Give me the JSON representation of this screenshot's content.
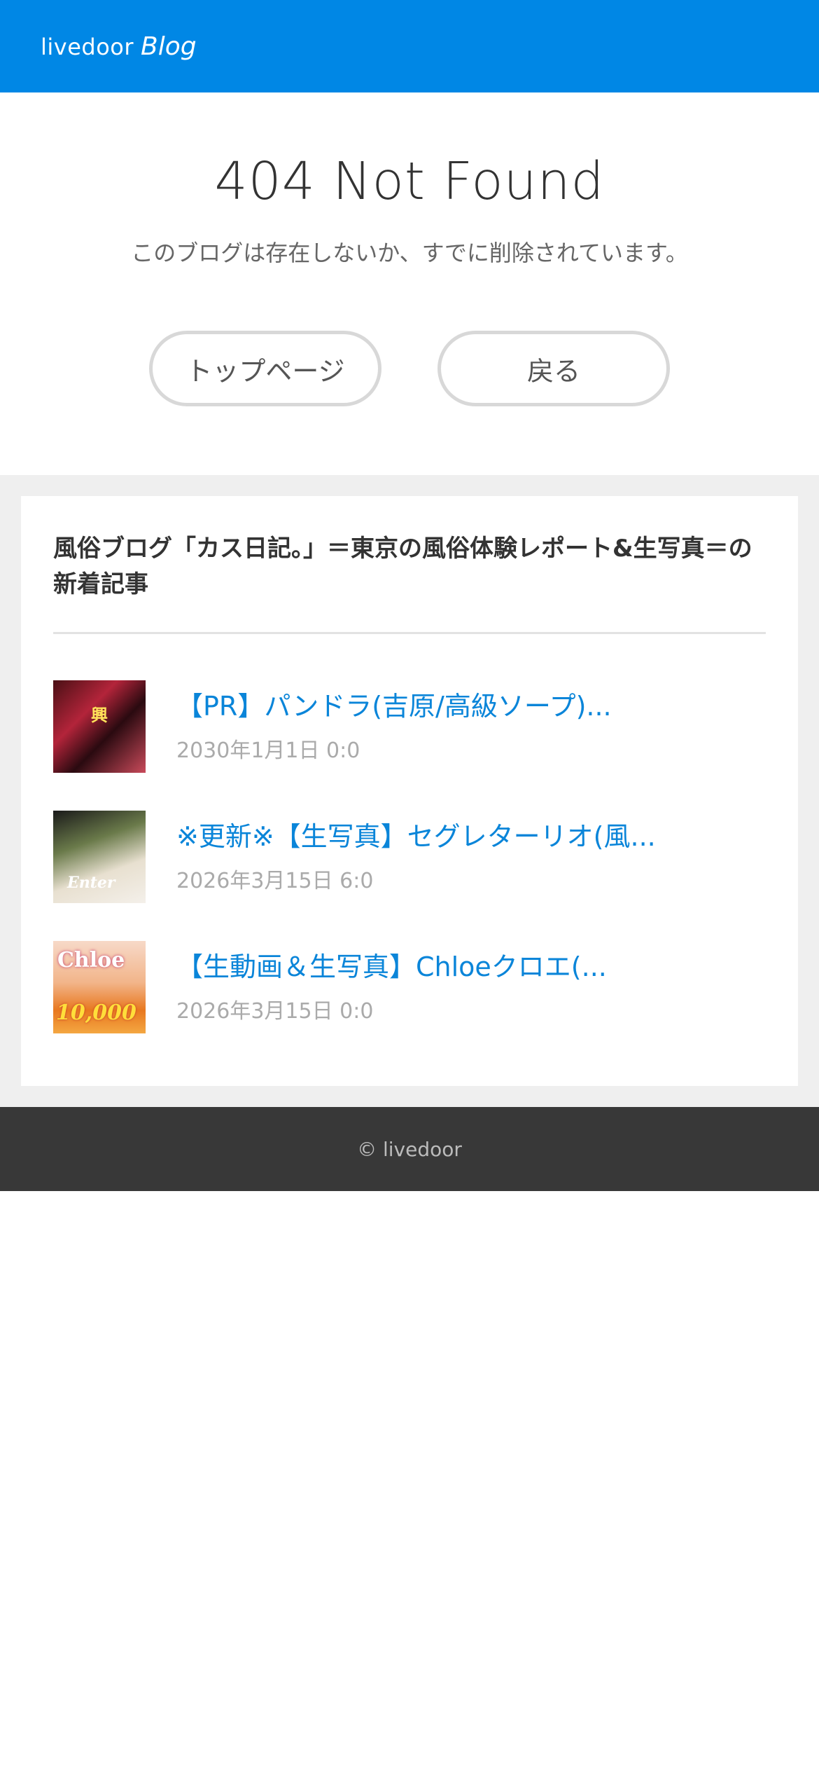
{
  "header": {
    "brand": "livedoor",
    "product": "Blog",
    "background_color": "#0087e5"
  },
  "error": {
    "title": "404 Not Found",
    "message": "このブログは存在しないか、すでに削除されています。",
    "top_button_label": "トップページ",
    "back_button_label": "戻る"
  },
  "recent": {
    "heading": "風俗ブログ「カス日記。」＝東京の風俗体験レポート&生写真＝の新着記事",
    "articles": [
      {
        "title": "【PR】パンドラ(吉原/高級ソープ)...",
        "date": "2030年1月1日 0:0",
        "thumb_text": "興"
      },
      {
        "title": "※更新※【生写真】セグレターリオ(風...",
        "date": "2026年3月15日 6:0",
        "thumb_text": "Enter"
      },
      {
        "title": "【生動画＆生写真】Chloeクロエ(...",
        "date": "2026年3月15日 0:0",
        "thumb_text": "Chloe",
        "thumb_subtext": "10,000"
      }
    ],
    "link_color": "#0a85d9"
  },
  "footer": {
    "copyright": "© livedoor"
  }
}
